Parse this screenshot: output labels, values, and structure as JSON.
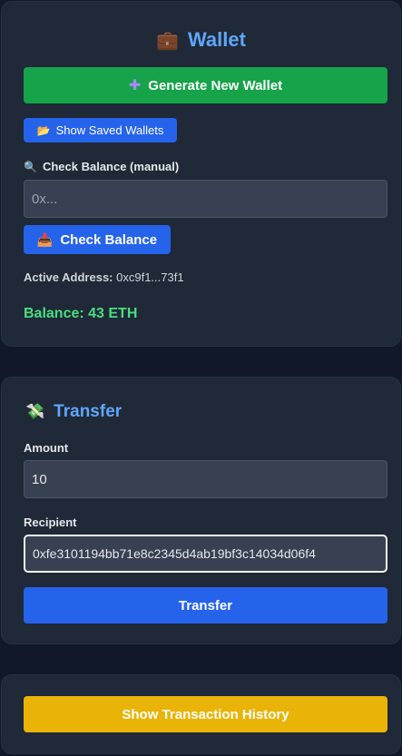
{
  "wallet": {
    "icon": "briefcase-icon",
    "title": "Wallet",
    "generate_icon": "sparkle-icon",
    "generate_label": "Generate New Wallet",
    "saved_icon": "folder-icon",
    "saved_label": "Show Saved Wallets",
    "check_icon": "magnifier-icon",
    "check_heading": "Check Balance (manual)",
    "address_placeholder": "0x...",
    "check_button_icon": "inbox-tray-icon",
    "check_button_label": "Check Balance",
    "active_address_label": "Active Address:",
    "active_address_value": "0xc9f1...73f1",
    "balance_text": "Balance: 43 ETH"
  },
  "transfer": {
    "icon": "money-with-wings-icon",
    "title": "Transfer",
    "amount_label": "Amount",
    "amount_value": "10",
    "recipient_label": "Recipient",
    "recipient_value": "0xfe3101194bb71e8c2345d4ab19bf3c14034d06f4",
    "submit_label": "Transfer"
  },
  "history": {
    "button_label": "Show Transaction History"
  },
  "colors": {
    "accent_blue": "#60a5fa",
    "generate_green": "#16a34a",
    "primary_blue": "#2563eb",
    "balance_green": "#4ade80",
    "history_yellow": "#eab308"
  }
}
